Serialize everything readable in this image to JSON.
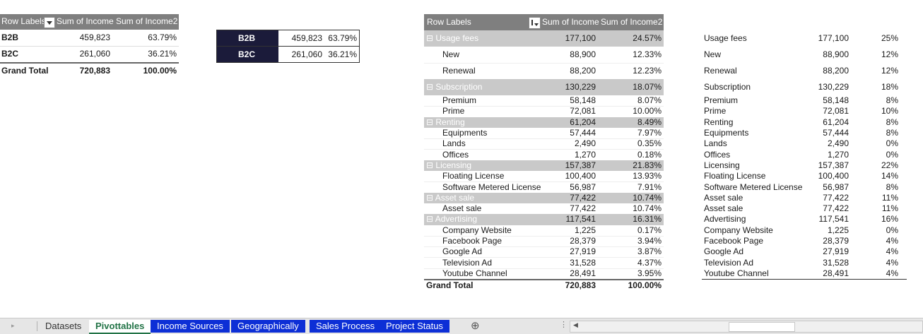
{
  "pivot1": {
    "headers": [
      "Row Labels",
      "Sum of Income",
      "Sum of Income2"
    ],
    "rows": [
      {
        "label": "B2B",
        "income": "459,823",
        "pct": "63.79%"
      },
      {
        "label": "B2C",
        "income": "261,060",
        "pct": "36.21%"
      }
    ],
    "total": {
      "label": "Grand Total",
      "income": "720,883",
      "pct": "100.00%"
    }
  },
  "mini": {
    "rows": [
      {
        "label": "B2B",
        "income": "459,823",
        "pct": "63.79%"
      },
      {
        "label": "B2C",
        "income": "261,060",
        "pct": "36.21%"
      }
    ]
  },
  "pivot2": {
    "headers": [
      "Row Labels",
      "Sum of Income",
      "Sum of Income2"
    ],
    "rows": [
      {
        "label": "⊟ Usage fees",
        "income": "177,100",
        "pct": "24.57%",
        "group": true
      },
      {
        "label": "New",
        "income": "88,900",
        "pct": "12.33%"
      },
      {
        "label": "Renewal",
        "income": "88,200",
        "pct": "12.23%"
      },
      {
        "label": "⊟ Subscription",
        "income": "130,229",
        "pct": "18.07%",
        "group": true
      },
      {
        "label": "Premium",
        "income": "58,148",
        "pct": "8.07%"
      },
      {
        "label": "Prime",
        "income": "72,081",
        "pct": "10.00%"
      },
      {
        "label": "⊟ Renting",
        "income": "61,204",
        "pct": "8.49%",
        "group": true
      },
      {
        "label": "Equipments",
        "income": "57,444",
        "pct": "7.97%"
      },
      {
        "label": "Lands",
        "income": "2,490",
        "pct": "0.35%"
      },
      {
        "label": "Offices",
        "income": "1,270",
        "pct": "0.18%"
      },
      {
        "label": "⊟ Licensing",
        "income": "157,387",
        "pct": "21.83%",
        "group": true
      },
      {
        "label": "Floating License",
        "income": "100,400",
        "pct": "13.93%"
      },
      {
        "label": "Software Metered License",
        "income": "56,987",
        "pct": "7.91%"
      },
      {
        "label": "⊟ Asset sale",
        "income": "77,422",
        "pct": "10.74%",
        "group": true
      },
      {
        "label": "Asset sale",
        "income": "77,422",
        "pct": "10.74%"
      },
      {
        "label": "⊟ Advertising",
        "income": "117,541",
        "pct": "16.31%",
        "group": true
      },
      {
        "label": "Company Website",
        "income": "1,225",
        "pct": "0.17%"
      },
      {
        "label": "Facebook Page",
        "income": "28,379",
        "pct": "3.94%"
      },
      {
        "label": "Google Ad",
        "income": "27,919",
        "pct": "3.87%"
      },
      {
        "label": "Television Ad",
        "income": "31,528",
        "pct": "4.37%"
      },
      {
        "label": "Youtube Channel",
        "income": "28,491",
        "pct": "3.95%"
      }
    ],
    "total": {
      "label": "Grand Total",
      "income": "720,883",
      "pct": "100.00%"
    }
  },
  "plain_table": {
    "rows": [
      {
        "label": "Usage fees",
        "income": "177,100",
        "pct": "25%"
      },
      {
        "label": "New",
        "income": "88,900",
        "pct": "12%"
      },
      {
        "label": "Renewal",
        "income": "88,200",
        "pct": "12%"
      },
      {
        "label": "Subscription",
        "income": "130,229",
        "pct": "18%"
      },
      {
        "label": "Premium",
        "income": "58,148",
        "pct": "8%"
      },
      {
        "label": "Prime",
        "income": "72,081",
        "pct": "10%"
      },
      {
        "label": "Renting",
        "income": "61,204",
        "pct": "8%"
      },
      {
        "label": "Equipments",
        "income": "57,444",
        "pct": "8%"
      },
      {
        "label": "Lands",
        "income": "2,490",
        "pct": "0%"
      },
      {
        "label": "Offices",
        "income": "1,270",
        "pct": "0%"
      },
      {
        "label": "Licensing",
        "income": "157,387",
        "pct": "22%"
      },
      {
        "label": "Floating License",
        "income": "100,400",
        "pct": "14%"
      },
      {
        "label": "Software Metered License",
        "income": "56,987",
        "pct": "8%"
      },
      {
        "label": "Asset sale",
        "income": "77,422",
        "pct": "11%"
      },
      {
        "label": "Asset sale",
        "income": "77,422",
        "pct": "11%"
      },
      {
        "label": "Advertising",
        "income": "117,541",
        "pct": "16%"
      },
      {
        "label": "Company Website",
        "income": "1,225",
        "pct": "0%"
      },
      {
        "label": "Facebook Page",
        "income": "28,379",
        "pct": "4%"
      },
      {
        "label": "Google Ad",
        "income": "27,919",
        "pct": "4%"
      },
      {
        "label": "Television Ad",
        "income": "31,528",
        "pct": "4%"
      },
      {
        "label": "Youtube Channel",
        "income": "28,491",
        "pct": "4%"
      }
    ]
  },
  "sheet_tabs": [
    {
      "label": "Datasets",
      "style": "plain"
    },
    {
      "label": "Pivottables",
      "style": "active"
    },
    {
      "label": "Income Sources",
      "style": "blue"
    },
    {
      "label": "Geographically",
      "style": "blue"
    },
    {
      "label": "Sales Process",
      "style": "blue"
    },
    {
      "label": "Project Status",
      "style": "blue"
    }
  ],
  "tabbar_icons": {
    "add": "plus-circle-icon",
    "scroll_left": "triangle-left-icon"
  },
  "colors": {
    "tab_blue": "#0d2fd6",
    "excel_green": "#217346",
    "mini_dark": "#1b1b3a"
  }
}
